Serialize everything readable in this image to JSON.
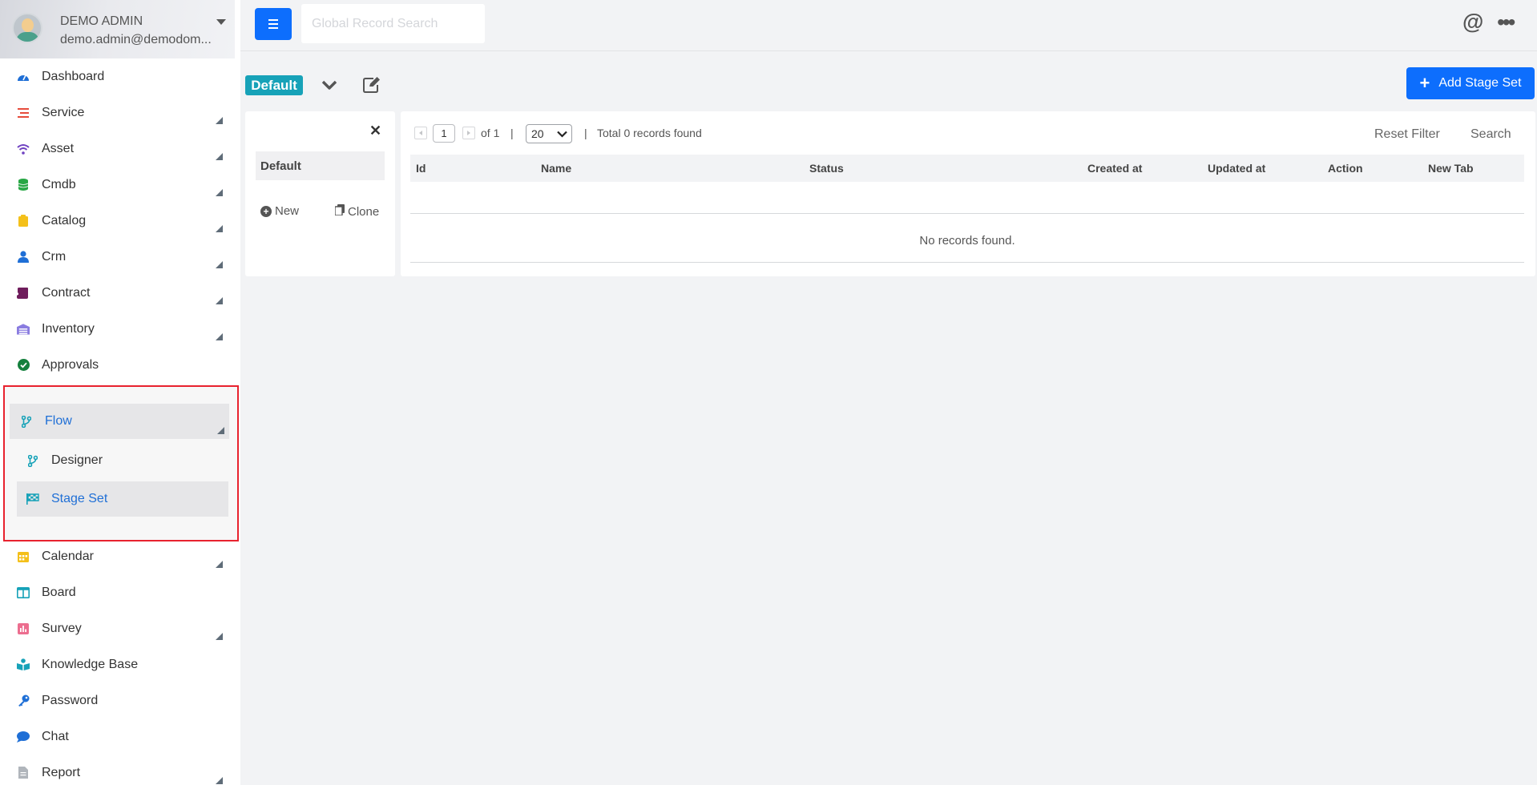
{
  "profile": {
    "name": "DEMO ADMIN",
    "email": "demo.admin@demodom..."
  },
  "nav": {
    "items": [
      {
        "label": "Dashboard",
        "icon": "gauge-icon",
        "color": "#1f6fd6"
      },
      {
        "label": "Service",
        "icon": "list-icon",
        "color": "#e74c3c"
      },
      {
        "label": "Asset",
        "icon": "wifi-icon",
        "color": "#6f42c1"
      },
      {
        "label": "Cmdb",
        "icon": "database-icon",
        "color": "#28a745"
      },
      {
        "label": "Catalog",
        "icon": "clipboard-icon",
        "color": "#f4c01a"
      },
      {
        "label": "Crm",
        "icon": "user-icon",
        "color": "#1f6fd6"
      },
      {
        "label": "Contract",
        "icon": "scroll-icon",
        "color": "#6f1d5c"
      },
      {
        "label": "Inventory",
        "icon": "warehouse-icon",
        "color": "#8a7ce0"
      },
      {
        "label": "Approvals",
        "icon": "check-circle-icon",
        "color": "#15803d"
      }
    ],
    "flow": {
      "label": "Flow",
      "icon": "code-branch-icon",
      "color": "#17a2b8"
    },
    "flow_sub": [
      {
        "label": "Designer",
        "icon": "code-branch-icon"
      },
      {
        "label": "Stage Set",
        "icon": "flag-checkered-icon"
      }
    ],
    "items_after": [
      {
        "label": "Calendar",
        "icon": "calendar-icon",
        "color": "#f4c01a"
      },
      {
        "label": "Board",
        "icon": "columns-icon",
        "color": "#17a2b8"
      },
      {
        "label": "Survey",
        "icon": "poll-icon",
        "color": "#ec6e8f"
      },
      {
        "label": "Knowledge Base",
        "icon": "book-reader-icon",
        "color": "#17a2b8"
      },
      {
        "label": "Password",
        "icon": "key-icon",
        "color": "#1f6fd6"
      },
      {
        "label": "Chat",
        "icon": "comment-icon",
        "color": "#1f6fd6"
      },
      {
        "label": "Report",
        "icon": "file-icon",
        "color": "#b0b5bb"
      }
    ]
  },
  "topbar": {
    "search_placeholder": "Global Record Search"
  },
  "toolbar": {
    "badge": "Default",
    "add_label": "Add Stage Set"
  },
  "leftpanel": {
    "default_label": "Default",
    "new_label": "New",
    "clone_label": "Clone"
  },
  "pagination": {
    "page": "1",
    "of_label": "of 1",
    "sep": "|",
    "page_size": "20",
    "total": "Total 0 records found"
  },
  "filters": {
    "reset": "Reset Filter",
    "search": "Search"
  },
  "table": {
    "columns": [
      "Id",
      "Name",
      "Status",
      "Created at",
      "Updated at",
      "Action",
      "New Tab"
    ],
    "empty": "No records found."
  }
}
